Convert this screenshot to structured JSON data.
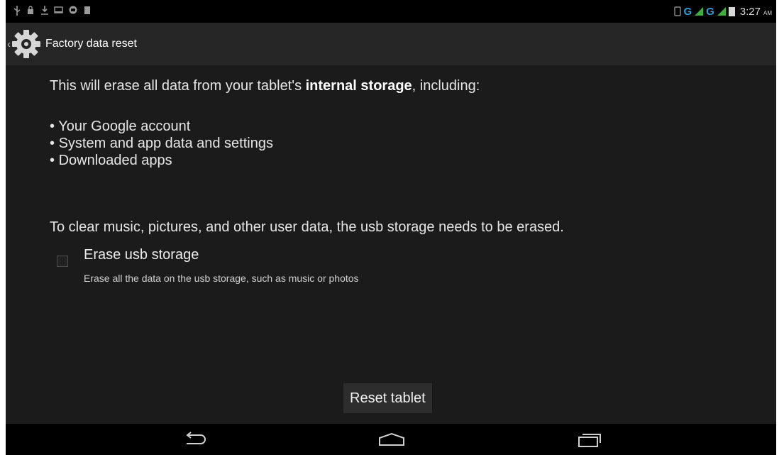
{
  "status_bar": {
    "left_icons": [
      "usb-icon",
      "lock-icon",
      "download-icon",
      "mail-icon",
      "android-debug-icon",
      "sd-card-icon"
    ],
    "network_label_1": "G",
    "network_label_2": "G",
    "time": "3:27",
    "ampm": "AM"
  },
  "action_bar": {
    "icon": "settings-gear-icon",
    "title": "Factory data reset"
  },
  "content": {
    "intro_prefix": "This will erase all data from your tablet's ",
    "intro_bold": "internal storage",
    "intro_suffix": ", including:",
    "bullets": [
      "Your Google account",
      "System and app data and settings",
      "Downloaded apps"
    ],
    "usb_note": "To clear music, pictures, and other user data, the usb storage needs to be erased.",
    "erase_usb": {
      "title": "Erase usb storage",
      "summary": "Erase all the data on the usb storage, such as music or photos",
      "checked": false
    },
    "reset_button_label": "Reset tablet"
  },
  "nav_bar": {
    "buttons": [
      "back-icon",
      "home-icon",
      "recent-apps-icon"
    ]
  },
  "colors": {
    "background": "#1b1b1b",
    "action_bar": "#262626",
    "network_accent": "#2f9fd4",
    "signal_green": "#3fae3f"
  }
}
